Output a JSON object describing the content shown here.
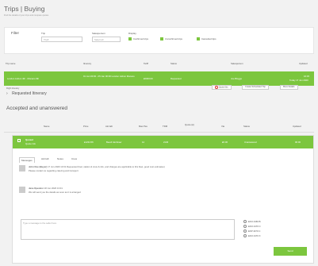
{
  "header": {
    "title": "Trips | Buying",
    "subtitle": "Find the details of your trips and compare quotes"
  },
  "filter": {
    "label": "Filter",
    "trip": {
      "label": "Trip",
      "placeholder": "Trip#"
    },
    "salesperson": {
      "label": "Salesperson",
      "value": "Select all"
    },
    "display": {
      "label": "Display",
      "options": [
        "Confirmed trips",
        "Unconfirmed trips",
        "Cancelled trips"
      ]
    }
  },
  "trips_table": {
    "columns": [
      "Trip name",
      "Itinerary",
      "Tariff",
      "Status",
      "Salesperson",
      "Updated"
    ],
    "row": {
      "trip_name": "London Lisbon 4th - Monaco 6th",
      "itinerary": "01 Jan 00:00 - 05 Jan 00:00 London Lisbon Monaco",
      "tariff": "£0000.00",
      "status": "Requested",
      "salesperson": "Joe Bloggs",
      "updated": "16:45",
      "updated2": "Today 17 Jun 2020"
    }
  },
  "actions": {
    "quote": "Quote this",
    "create": "Create Scheduled Trip",
    "more": "More Details"
  },
  "itinerary": {
    "caption": "Flight itinerary",
    "label": "Requested Itinerary"
  },
  "accepted": {
    "heading": "Accepted and unanswered",
    "columns": [
      "Name",
      "Price",
      "Aircraft",
      "Max Pax",
      "TDM",
      "Quote (£)",
      "Via",
      "Status",
      "Updated"
    ],
    "row": {
      "name": "Quoted",
      "subname": "Quote info",
      "price": "£1234.56",
      "aircraft": "Beech Embraer",
      "maxpax": "12",
      "tdm": "2140",
      "quote": "£6.00",
      "status": "Unanswered",
      "updated": "00:00"
    }
  },
  "tabs": [
    "Messages",
    "Aircraft",
    "Notes",
    "Crew"
  ],
  "messages": [
    {
      "author": "John Doe (Buyer)",
      "time": "17 Jun 2020 13:31",
      "text": "Requested (fuel, station & crew & info, and charges are applicable to this fleet, good cost estimates)",
      "text2": "Please contact us regarding catering and transport"
    },
    {
      "author": "Jane Operator",
      "time": "18 Jun 2020 13:31",
      "text": "We will send you the details as soon as it is arranged"
    }
  ],
  "compose": {
    "placeholder": "Type a message to the seller here"
  },
  "recipients": [
    "EKO 4466 B",
    "EKO 4470 C",
    "EKP 4470 C",
    "EKO 4470 X"
  ],
  "send_label": "Send"
}
